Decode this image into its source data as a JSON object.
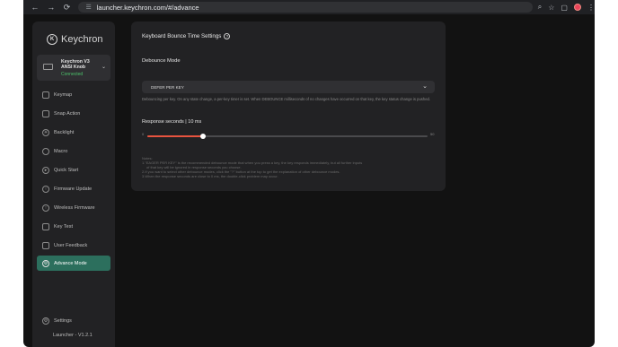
{
  "browser": {
    "url": "launcher.keychron.com/#/advance",
    "back_icon": "←",
    "forward_icon": "→",
    "reload_icon": "⟳",
    "zoom_icon": "⌕",
    "star_icon": "☆",
    "ext_icon": "▢",
    "menu_icon": "⋮"
  },
  "sidebar": {
    "brand": "Keychron",
    "device": {
      "name": "Keychron V3 ANSI Knob",
      "status": "Connected",
      "status_color": "#4cc36b"
    },
    "items": [
      {
        "label": "Keymap",
        "icon": "keymap-icon"
      },
      {
        "label": "Snap Action",
        "icon": "snap-action-icon"
      },
      {
        "label": "Backlight",
        "icon": "backlight-icon"
      },
      {
        "label": "Macro",
        "icon": "macro-icon"
      },
      {
        "label": "Quick Start",
        "icon": "quick-start-icon"
      },
      {
        "label": "Firmware Update",
        "icon": "firmware-icon"
      },
      {
        "label": "Wireless Firmware",
        "icon": "wireless-icon"
      },
      {
        "label": "Key Test",
        "icon": "key-test-icon"
      },
      {
        "label": "User Feedback",
        "icon": "feedback-icon"
      },
      {
        "label": "Advance Mode",
        "icon": "advance-icon",
        "active": true
      }
    ],
    "settings_label": "Settings",
    "version": "Launcher - V1.2.1",
    "accent": "#2c6f5d"
  },
  "main": {
    "title": "Keyboard Bounce Time Settings",
    "debounce_label": "Debounce Mode",
    "selected_mode": "DEFER PER KEY",
    "mode_description": "Debouncing per key. On any state change, a per-key timer is set. When DEBOUNCE milliseconds of no changes have occurred on that key, the key status change is pushed.",
    "response_label": "Response seconds | 10 ms",
    "slider": {
      "min": "0",
      "max": "50",
      "value": 10,
      "min_value": 0,
      "max_value": 50,
      "color": "#e8543f"
    },
    "notes": [
      "Notes:",
      "1.\"EAGER PER KEY\" is the recommended debounce mode that when you press a key, the key responds immediately, but all further inputs",
      "   of that key will be ignored in response seconds you choose.",
      "2.If you want to select other debounce modes, click the \"?\" button at the top to get the explanation of other debounce modes.",
      "3.When the response seconds are close to 0 ms, the double-click problem may occur."
    ]
  }
}
